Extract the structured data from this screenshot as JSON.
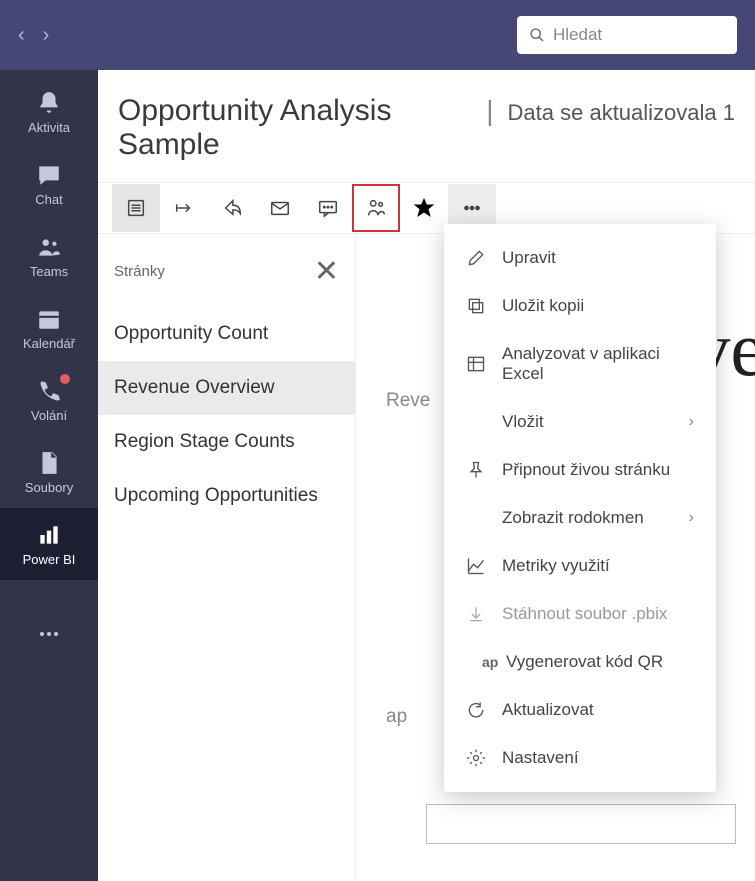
{
  "search": {
    "placeholder": "Hledat"
  },
  "rail": {
    "items": [
      {
        "label": "Aktivita"
      },
      {
        "label": "Chat"
      },
      {
        "label": "Teams"
      },
      {
        "label": "Kalendář"
      },
      {
        "label": "Volání"
      },
      {
        "label": "Soubory"
      },
      {
        "label": "Power BI"
      }
    ]
  },
  "header": {
    "title": "Opportunity Analysis Sample",
    "separator": "|",
    "subtitle": "Data se aktualizovala 1"
  },
  "pages": {
    "heading": "Stránky",
    "items": [
      {
        "label": "Opportunity Count"
      },
      {
        "label": "Revenue Overview"
      },
      {
        "label": "Region Stage Counts"
      },
      {
        "label": "Upcoming Opportunities"
      }
    ],
    "selected_index": 1
  },
  "canvas": {
    "big_fragment": "ve",
    "small_fragment": "Reve",
    "ap_fragment": "ap"
  },
  "context_menu": {
    "edit": "Upravit",
    "save_copy": "Uložit kopii",
    "analyze_excel": "Analyzovat v aplikaci Excel",
    "embed": "Vložit",
    "pin_live": "Připnout živou stránku",
    "lineage": "Zobrazit rodokmen",
    "usage_metrics": "Metriky využití",
    "download_pbix": "Stáhnout soubor .pbix",
    "generate_qr": "Vygenerovat kód QR",
    "qr_prefix": "ap",
    "refresh": "Aktualizovat",
    "settings": "Nastavení"
  }
}
